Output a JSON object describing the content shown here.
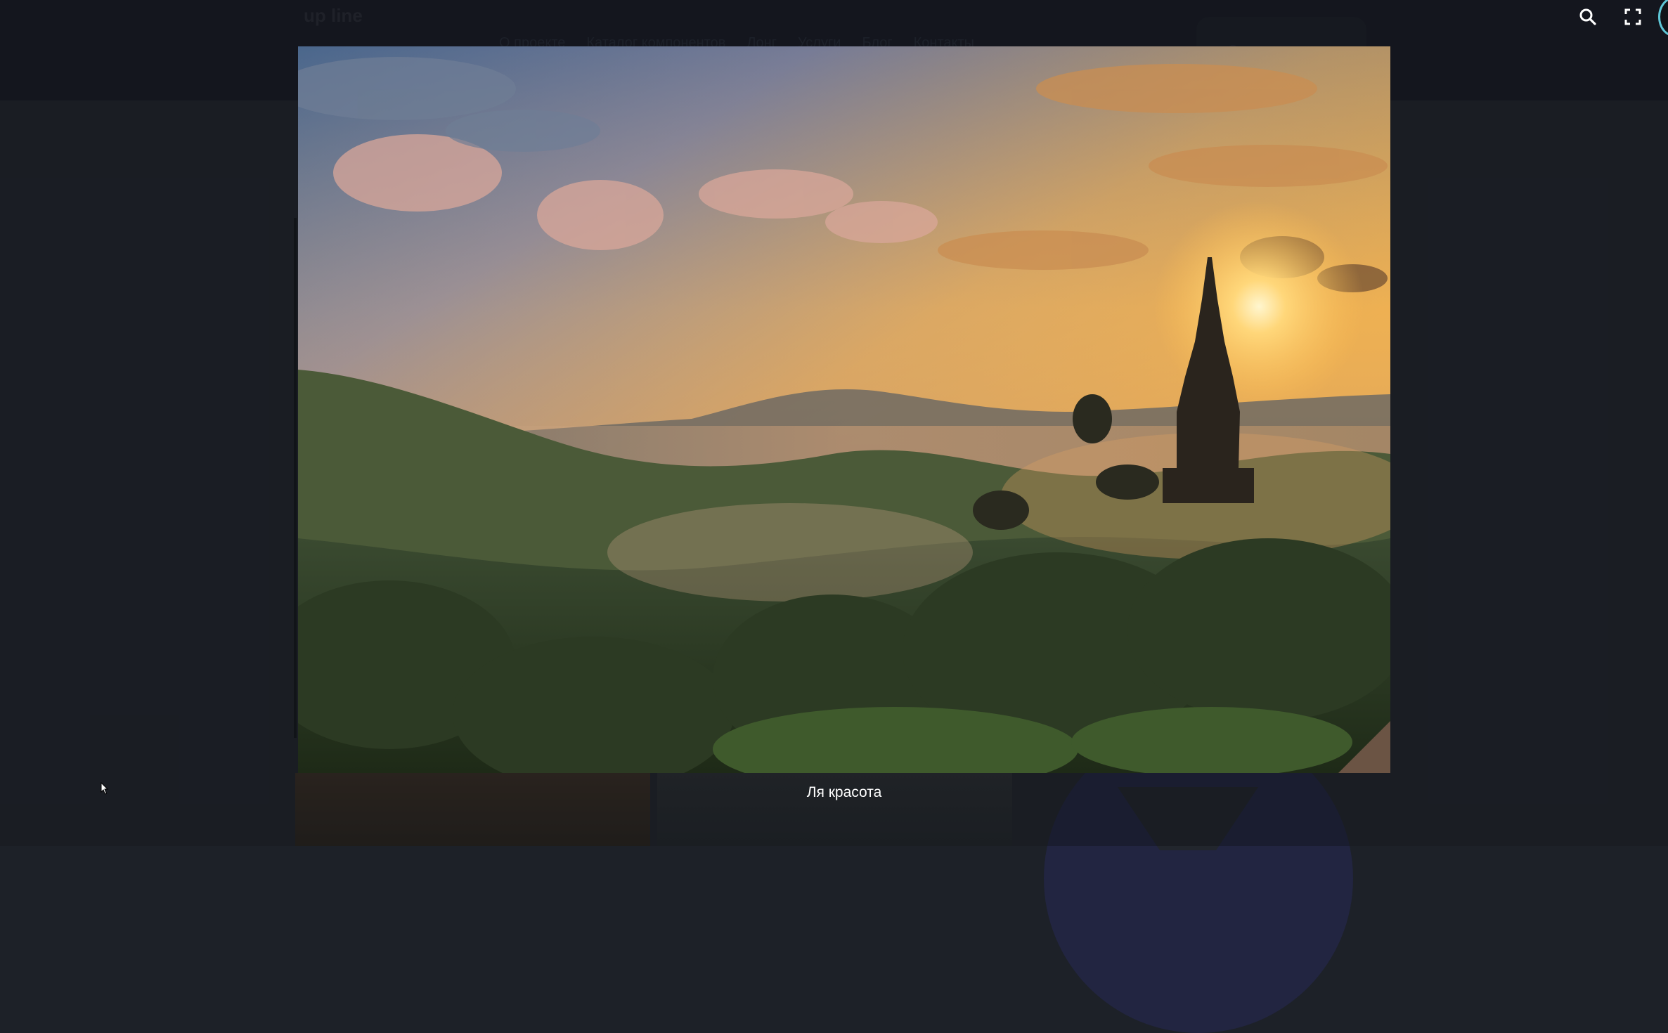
{
  "site": {
    "logo": "up line",
    "nav": [
      "О проекте",
      "Каталог компонентов",
      "Лонг",
      "Услуги",
      "Блог",
      "Контакты"
    ],
    "cta_label": "Оставить заявку"
  },
  "lightbox": {
    "caption": "Ля красота",
    "toolbar": {
      "search_icon": "search-icon",
      "fullscreen_icon": "fullscreen-icon"
    },
    "image_description_icon": "landscape-photo"
  }
}
